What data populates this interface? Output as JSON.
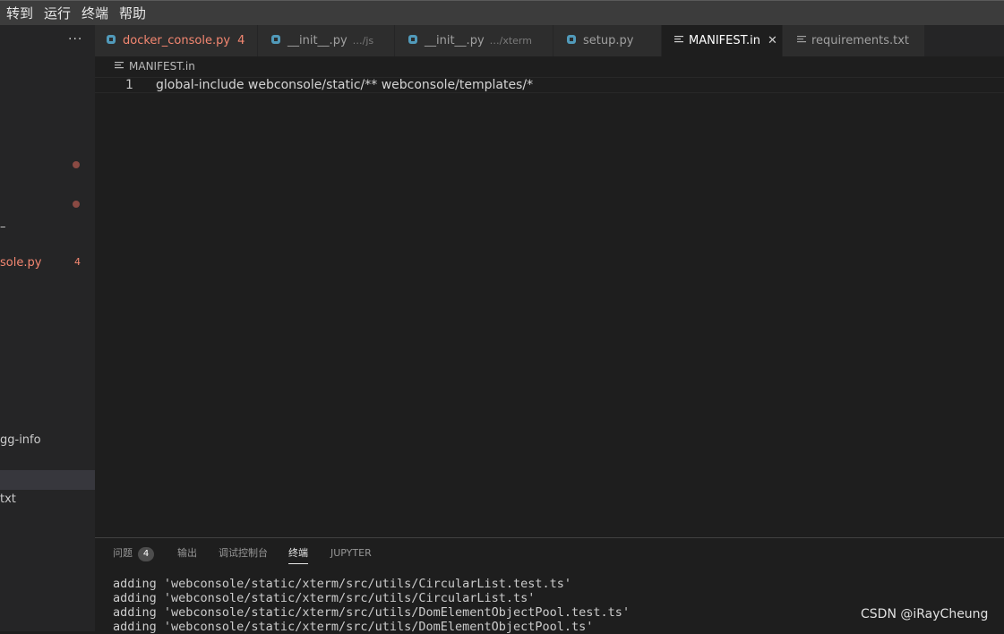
{
  "menu": [
    "转到",
    "运行",
    "终端",
    "帮助"
  ],
  "sidebar": {
    "more": "···",
    "items": [
      {
        "label": "–"
      },
      {
        "label": "sole.py",
        "badge": "4"
      },
      {
        "label": "gg-info"
      },
      {
        "label": "txt"
      }
    ]
  },
  "tabs": [
    {
      "label": "docker_console.py",
      "count": "4",
      "type": "python"
    },
    {
      "label": "__init__.py",
      "hint": "…/js",
      "type": "python"
    },
    {
      "label": "__init__.py",
      "hint": "…/xterm",
      "type": "python"
    },
    {
      "label": "setup.py",
      "type": "python"
    },
    {
      "label": "MANIFEST.in",
      "type": "text",
      "active": true,
      "close": "✕"
    },
    {
      "label": "requirements.txt",
      "type": "text"
    }
  ],
  "breadcrumb": "MANIFEST.in",
  "editor": {
    "line_number": "1",
    "code": "global-include webconsole/static/** webconsole/templates/*"
  },
  "panel": {
    "tabs": [
      {
        "label": "问题",
        "badge": "4"
      },
      {
        "label": "输出"
      },
      {
        "label": "调试控制台"
      },
      {
        "label": "终端",
        "active": true
      },
      {
        "label": "JUPYTER"
      }
    ],
    "terminal_lines": [
      "adding 'webconsole/static/xterm/src/utils/CircularList.test.ts'",
      "adding 'webconsole/static/xterm/src/utils/CircularList.ts'",
      "adding 'webconsole/static/xterm/src/utils/DomElementObjectPool.test.ts'",
      "adding 'webconsole/static/xterm/src/utils/DomElementObjectPool.ts'"
    ]
  },
  "watermark": "CSDN @iRayCheung",
  "colors": {
    "error": "#f48771",
    "python_icon": "#519aba"
  }
}
